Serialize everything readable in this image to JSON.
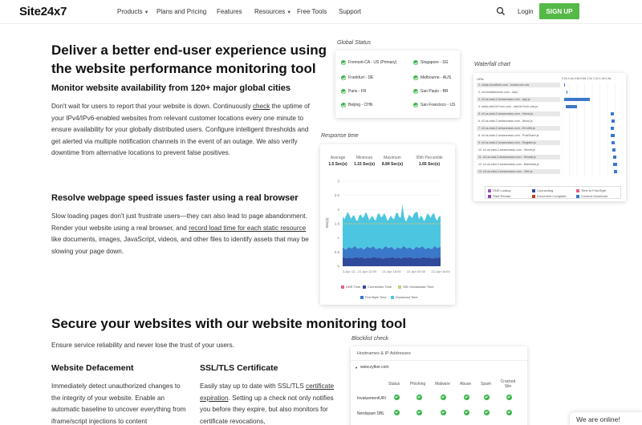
{
  "nav": {
    "logo": "Site24x7",
    "items": [
      "Products",
      "Plans and Pricing",
      "Features",
      "Resources",
      "Free Tools",
      "Support"
    ],
    "login": "Login",
    "signup": "SIGN UP",
    "accent": "#55b947"
  },
  "hero": {
    "title": "Deliver a better end-user experience using the website performance monitoring tool",
    "sub1": "Monitor website availability from 120+ major global cities",
    "p1_a": "Don't wait for users to report that your website is down. Continuously ",
    "p1_link": "check",
    "p1_b": " the uptime of your IPv4/IPv6-enabled websites from relevant customer locations every one minute to ensure availability for your globally distributed users. Configure intelligent thresholds and get alerted via multiple notification channels in the event of an outage. We also verify downtime from alternative locations to prevent false positives.",
    "sub2": "Resolve webpage speed issues faster using a real browser",
    "p2_a": "Slow loading pages don't just frustrate users—they can also lead to page abandonment. Render your website using a real browser, and ",
    "p2_link": "record load time for each static resource",
    "p2_b": " like documents, images, JavaScript, videos, and other files to identify assets that may be slowing your page down."
  },
  "secure": {
    "title": "Secure your websites with our website monitoring tool",
    "sub": "Ensure service reliability and never lose the trust of your users.",
    "col1_title": "Website Defacement",
    "col1_text": "Immediately detect unauthorized changes to the integrity of your website. Enable an automatic baseline to uncover everything from iframe/script injections to content",
    "col2_title": "SSL/TLS Certificate",
    "col2_text_a": "Easily stay up to date with SSL/TLS ",
    "col2_link": "certificate expiration",
    "col2_text_b": ". Setting up a check not only notifies you before they expire, but also monitors for certificate revocations,"
  },
  "global_status": {
    "label": "Global Status",
    "locations": [
      "Fremont-CA - US (Primary)",
      "Singapore - SG",
      "Frankfurt - DE",
      "Melbourne - AUS",
      "Paris - FR",
      "Sao Paulo - BR",
      "Beijing - CHN",
      "San Francisco - US"
    ]
  },
  "response_time": {
    "label": "Response time",
    "stats": [
      {
        "head": "Average",
        "val": "1.5 Sec(s)"
      },
      {
        "head": "Minimum",
        "val": "1.15 Sec(s)"
      },
      {
        "head": "Maximum",
        "val": "8.84 Sec(s)"
      },
      {
        "head": "95th Percentile",
        "val": "1.65 Sec(s)"
      }
    ],
    "ylabel": "Sec(s)",
    "legend": [
      "DNS Time",
      "Connection Time",
      "SSL Handshake Time",
      "First Byte Time",
      "Download Time"
    ],
    "colors": {
      "dns": "#e85d8a",
      "connection": "#2f4a9a",
      "ssl": "#b7d77a",
      "firstbyte": "#3a78c9",
      "download": "#4cc6e0"
    }
  },
  "chart_data": {
    "type": "area",
    "x": [
      "3-Apr 12...",
      "21-Apr 12:00",
      "21-Apr 18:00",
      "22-Apr 00:00",
      "22-Apr 06:00"
    ],
    "yticks": [
      "0",
      "0.5",
      "1",
      "1.5",
      "2",
      "2.5",
      "3"
    ],
    "ylim": [
      0,
      3
    ],
    "ylabel": "Sec(s)",
    "series": [
      {
        "name": "Connection Time",
        "values": [
          0.3,
          0.3,
          0.3,
          0.3,
          0.3
        ]
      },
      {
        "name": "First Byte Time",
        "values": [
          0.3,
          0.35,
          0.3,
          0.3,
          0.3
        ]
      },
      {
        "name": "Download Time",
        "values": [
          1.0,
          1.1,
          1.0,
          1.2,
          1.1
        ]
      }
    ]
  },
  "waterfall": {
    "label": "Waterfall chart",
    "header": "URls",
    "scale": "0.2s 0.4s 0.6s 0.8s 1.0s 1.2s 1.4s 1.6s",
    "rows": [
      "1. cdnjs.cloudflare.com - bootra.min.css",
      "2. usi.fontawesome.com - all.js",
      "3. s3.us-east-2.amazonaws.com - app.js",
      "4. static.site24x7rum.com - site24x7rum-min.js",
      "5. s3.us-east-2.amazonaws.com - Home.js",
      "6. s3.us-east-2.amazonaws.com - About.js",
      "7. s3.us-east-2.amazonaws.com - ErrorKit.js",
      "8. s3.us-east-2.amazonaws.com - PostShare.js",
      "9. s3.us-east-2.amazonaws.com - Register.js",
      "10. s3.us-east-2.amazonaws.com - Secret.js",
      "11. s3.us-east-2.amazonaws.com - Sendat.js",
      "12. s3.us-east-2.amazonaws.com - Batchstar.js",
      "13. s3.us-east-2.amazonaws.com - Utils.js"
    ],
    "legend": [
      "DNS Lookup",
      "Connecting",
      "Time to First Byte",
      "Start Render",
      "Document Complete",
      "Content Download"
    ]
  },
  "blocklist": {
    "label": "Blocklist check",
    "header": "Hostnames & IP Addresses",
    "host": "www.zylker.com",
    "columns": [
      "Status",
      "Phishing",
      "Malware",
      "Abuse",
      "Spam",
      "Cracked Site"
    ],
    "rows": [
      "InvaluementURI",
      "Nordspam DBL"
    ]
  },
  "chat": "We are online!"
}
